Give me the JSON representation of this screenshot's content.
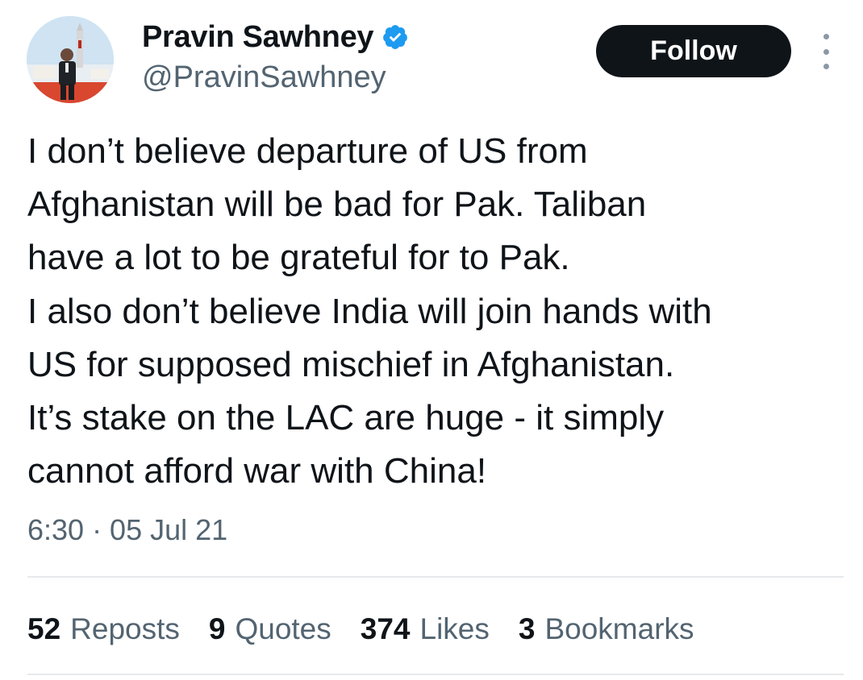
{
  "author": {
    "name": "Pravin Sawhney",
    "handle": "@PravinSawhney",
    "verified": true,
    "verified_color": "#1d9bf0"
  },
  "actions": {
    "follow_label": "Follow"
  },
  "tweet": {
    "text": "I don’t believe departure of US from\nAfghanistan will be bad for Pak. Taliban\nhave a lot to be grateful for to Pak.\nI also don’t believe India will join hands with\nUS for supposed mischief in Afghanistan.\nIt’s stake on the LAC are huge - it simply\ncannot afford war with China!",
    "timestamp": "6:30 · 05 Jul 21"
  },
  "stats": [
    {
      "count": "52",
      "label": "Reposts"
    },
    {
      "count": "9",
      "label": "Quotes"
    },
    {
      "count": "374",
      "label": "Likes"
    },
    {
      "count": "3",
      "label": "Bookmarks"
    }
  ],
  "icons": [
    "avatar",
    "verified-badge-icon",
    "more-options-icon"
  ]
}
